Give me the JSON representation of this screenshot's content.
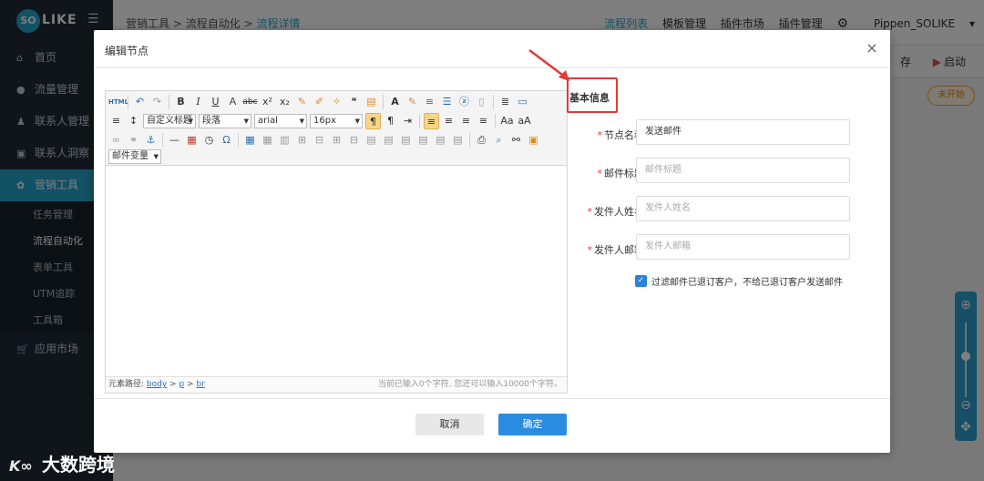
{
  "app": {
    "logo_mark": "SO",
    "logo_rest": "LIKE",
    "menu_toggle_icon": "☰"
  },
  "sidebar": {
    "items": [
      {
        "label": "首页",
        "icon": "home-icon"
      },
      {
        "label": "流量管理",
        "icon": "traffic-icon"
      },
      {
        "label": "联系人管理",
        "icon": "contacts-icon"
      },
      {
        "label": "联系人洞察",
        "icon": "insight-icon"
      },
      {
        "label": "营销工具",
        "icon": "marketing-icon"
      }
    ],
    "sub_items": [
      "任务管理",
      "流程自动化",
      "表单工具",
      "UTM追踪",
      "工具箱"
    ],
    "last_item": {
      "label": "应用市场",
      "icon": "cart-icon"
    }
  },
  "topbar": {
    "breadcrumb_1": "营销工具",
    "breadcrumb_sep": ">",
    "breadcrumb_2": "流程自动化",
    "breadcrumb_3": "流程详情",
    "nav": [
      "流程列表",
      "模板管理",
      "插件市场",
      "插件管理"
    ],
    "user": "Pippen_SOLIKE"
  },
  "canvas": {
    "save_label": "存",
    "start_label": "启动",
    "status_badge": "未开始"
  },
  "modal": {
    "title": "编辑节点",
    "close": "×",
    "section_title": "基本信息",
    "editor": {
      "selects": {
        "heading": "自定义标题",
        "paragraph": "段落",
        "font": "arial",
        "size": "16px",
        "mail_var": "邮件变量"
      },
      "path_label": "元素路径:",
      "path": [
        "body",
        "p",
        "br"
      ],
      "char_count": "当前已输入0个字符, 您还可以输入10000个字符。"
    },
    "form": {
      "node_name": {
        "label": "节点名称",
        "value": "发送邮件"
      },
      "mail_subject": {
        "label": "邮件标题",
        "placeholder": "邮件标题"
      },
      "sender_name": {
        "label": "发件人姓名",
        "placeholder": "发件人姓名"
      },
      "sender_email": {
        "label": "发件人邮箱",
        "placeholder": "发件人邮箱"
      },
      "filter_label": "过滤邮件已退订客户，不给已退订客户发送邮件",
      "filter_checked": true
    },
    "cancel_label": "取消",
    "ok_label": "确定"
  },
  "watermark": "大数跨境",
  "colors": {
    "accent": "#27a3c8",
    "primary_button": "#2a8ce0",
    "required": "#e53935",
    "sidebar_bg": "#1f2b34"
  }
}
